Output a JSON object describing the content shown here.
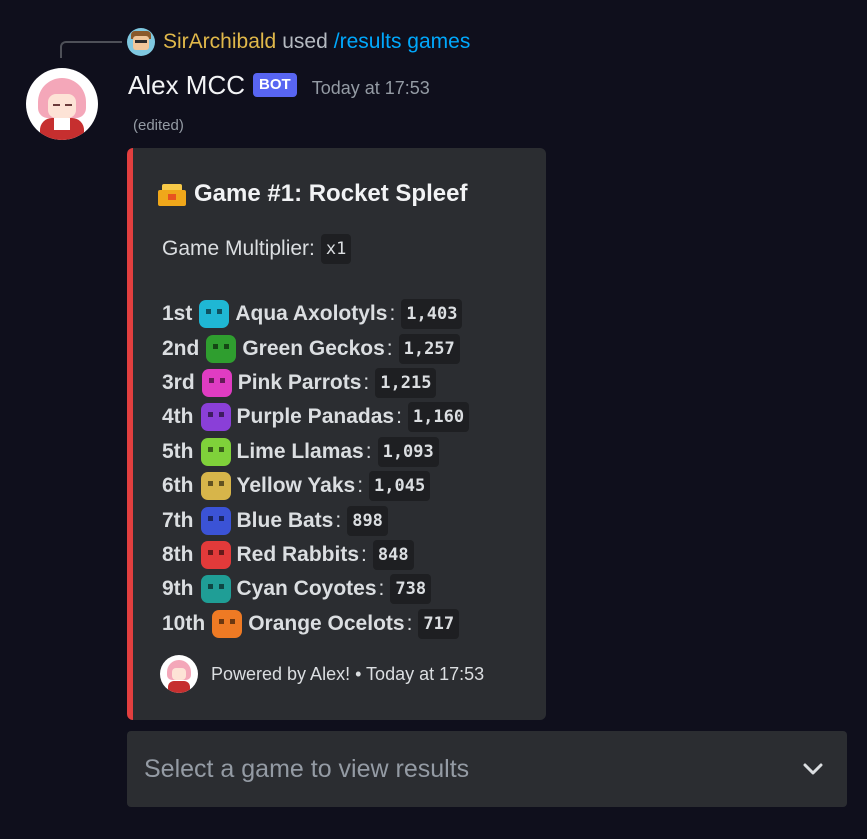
{
  "reply": {
    "user": "SirArchibald",
    "used": "used",
    "command": "/results games"
  },
  "message": {
    "author": "Alex MCC",
    "bot_tag": "BOT",
    "timestamp": "Today at 17:53",
    "edited": "(edited)"
  },
  "embed": {
    "accent_color": "#e23f3f",
    "title_icon": "crown-icon",
    "title": "Game #1: Rocket Spleef",
    "multiplier_label": "Game Multiplier:",
    "multiplier_value": "x1",
    "rankings": [
      {
        "rank": "1st",
        "team": "Aqua Axolotyls",
        "score": "1,403",
        "icon": "axolotl-icon",
        "color": "#1fb7d4"
      },
      {
        "rank": "2nd",
        "team": "Green Geckos",
        "score": "1,257",
        "icon": "gecko-icon",
        "color": "#2f9e2f"
      },
      {
        "rank": "3rd",
        "team": "Pink Parrots",
        "score": "1,215",
        "icon": "parrot-icon",
        "color": "#e03cc2"
      },
      {
        "rank": "4th",
        "team": "Purple Panadas",
        "score": "1,160",
        "icon": "panda-icon",
        "color": "#8a3fd8"
      },
      {
        "rank": "5th",
        "team": "Lime Llamas",
        "score": "1,093",
        "icon": "llama-icon",
        "color": "#7fd13a"
      },
      {
        "rank": "6th",
        "team": "Yellow Yaks",
        "score": "1,045",
        "icon": "yak-icon",
        "color": "#d7b54a"
      },
      {
        "rank": "7th",
        "team": "Blue Bats",
        "score": "898",
        "icon": "bat-icon",
        "color": "#3b53d6"
      },
      {
        "rank": "8th",
        "team": "Red Rabbits",
        "score": "848",
        "icon": "rabbit-icon",
        "color": "#e23a3a"
      },
      {
        "rank": "9th",
        "team": "Cyan Coyotes",
        "score": "738",
        "icon": "coyote-icon",
        "color": "#1f9e96"
      },
      {
        "rank": "10th",
        "team": "Orange Ocelots",
        "score": "717",
        "icon": "ocelot-icon",
        "color": "#ee7a24"
      }
    ],
    "footer": "Powered by Alex! • Today at 17:53"
  },
  "select": {
    "placeholder": "Select a game to view results"
  }
}
